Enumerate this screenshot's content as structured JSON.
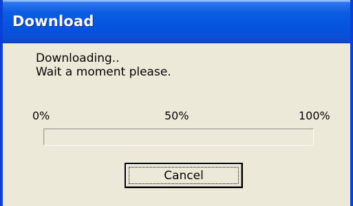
{
  "window": {
    "title": "Download"
  },
  "message": {
    "line1": "Downloading..",
    "line2": "Wait a moment please."
  },
  "progress": {
    "label_min": "0%",
    "label_mid": "50%",
    "label_max": "100%",
    "value_fraction": 0
  },
  "buttons": {
    "cancel_label": "Cancel"
  },
  "colors": {
    "title_bar": "#0655e0",
    "dialog_face": "#ece9d8",
    "progress_fill": "#316ac5"
  }
}
